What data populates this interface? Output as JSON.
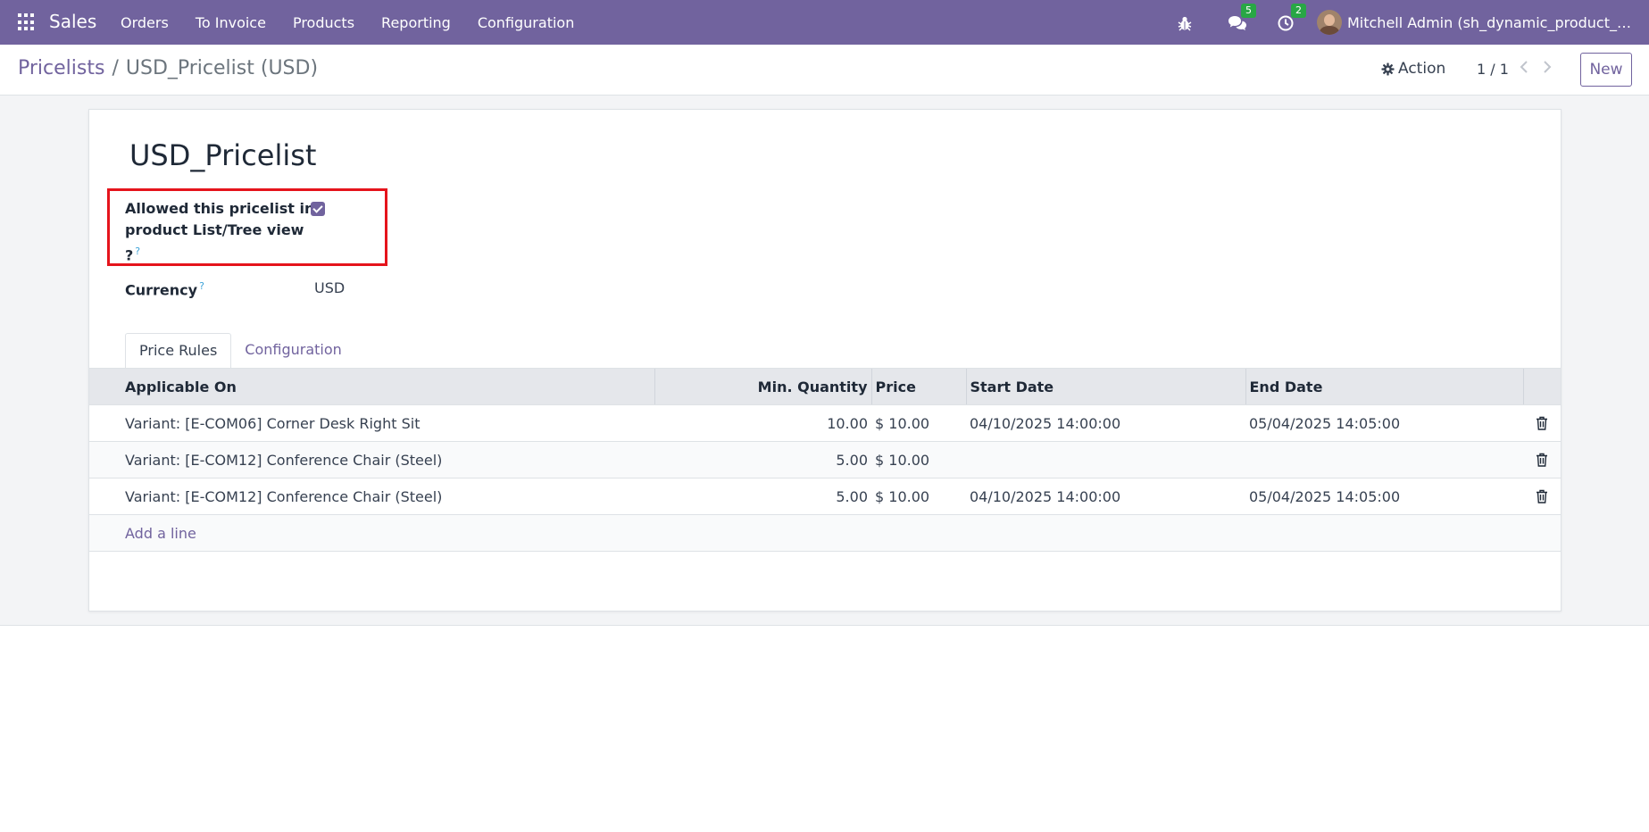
{
  "navbar": {
    "app_name": "Sales",
    "menu": [
      "Orders",
      "To Invoice",
      "Products",
      "Reporting",
      "Configuration"
    ],
    "messages_count": "5",
    "activities_count": "2",
    "user_name": "Mitchell Admin (sh_dynamic_product_…"
  },
  "breadcrumb": {
    "parent": "Pricelists",
    "separator": "/",
    "current": "USD_Pricelist (USD)"
  },
  "control": {
    "action_label": "Action",
    "pager": "1 / 1",
    "new_label": "New"
  },
  "record": {
    "title": "USD_Pricelist",
    "allowed_label_line1": "Allowed this pricelist in",
    "allowed_label_line2": "product List/Tree view",
    "allowed_label_line3": "?",
    "help_mark": "?",
    "allowed_checked": true,
    "currency_label": "Currency",
    "currency_value": "USD"
  },
  "tabs": [
    "Price Rules",
    "Configuration"
  ],
  "table": {
    "headers": [
      "Applicable On",
      "Min. Quantity",
      "Price",
      "Start Date",
      "End Date"
    ],
    "rows": [
      {
        "applicable_on": "Variant: [E-COM06] Corner Desk Right Sit",
        "min_qty": "10.00",
        "price": "$ 10.00",
        "start": "04/10/2025 14:00:00",
        "end": "05/04/2025 14:05:00"
      },
      {
        "applicable_on": "Variant: [E-COM12] Conference Chair (Steel)",
        "min_qty": "5.00",
        "price": "$ 10.00",
        "start": "",
        "end": ""
      },
      {
        "applicable_on": "Variant: [E-COM12] Conference Chair (Steel)",
        "min_qty": "5.00",
        "price": "$ 10.00",
        "start": "04/10/2025 14:00:00",
        "end": "05/04/2025 14:05:00"
      }
    ],
    "add_line": "Add a line"
  },
  "colors": {
    "brand": "#71639e",
    "highlight": "#e5141c",
    "badge": "#28a745"
  }
}
